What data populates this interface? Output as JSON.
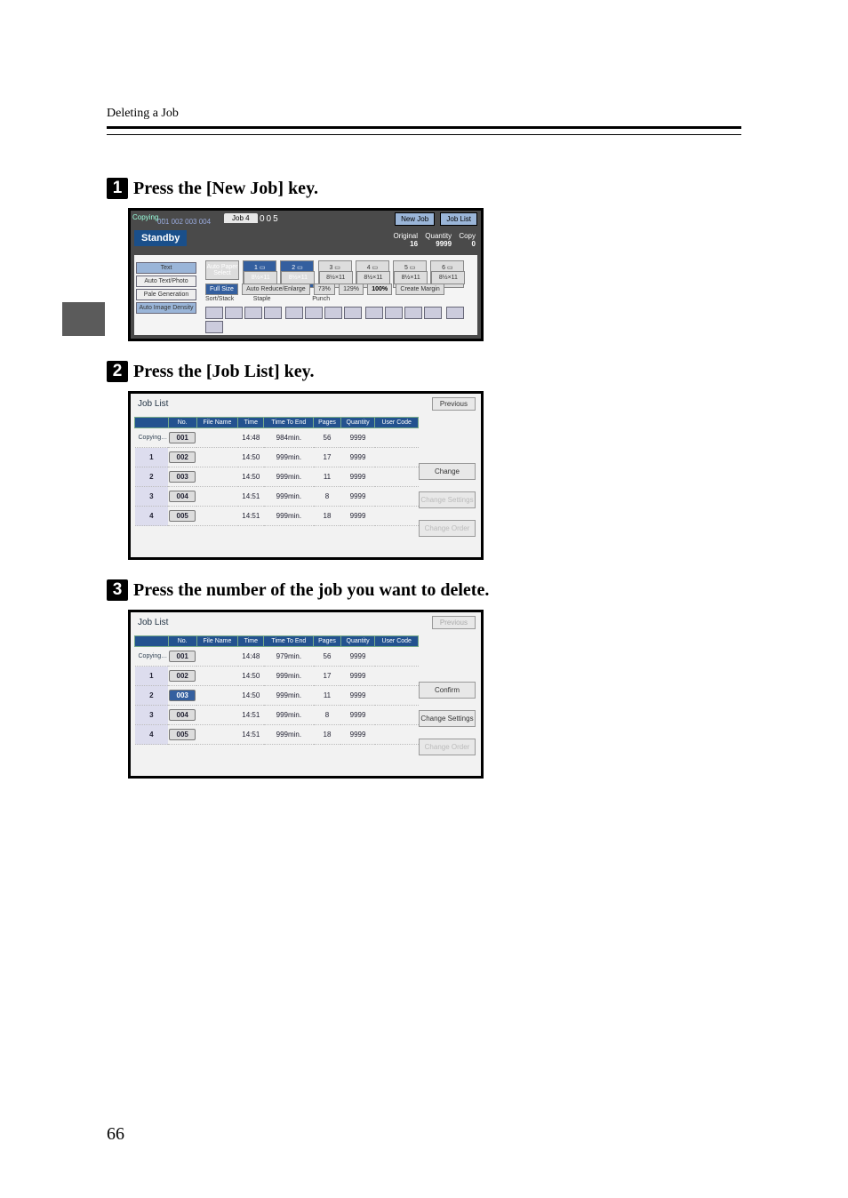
{
  "section_title": "Deleting a Job",
  "steps": {
    "s1_pre": "Press the ",
    "s1_key": "[New Job]",
    "s1_post": " key.",
    "s2_pre": "Press the ",
    "s2_key": "[Job List]",
    "s2_post": " key.",
    "s3": "Press the number of the job you want to delete."
  },
  "page_number": "66",
  "panel1": {
    "copying": "Copying…",
    "tabs": "001  002  003  004",
    "jobtab": "Job 4",
    "jobtab2": "005",
    "new_job": "New Job",
    "job_list": "Job List",
    "standby": "Standby",
    "original_lbl": "Original",
    "original_val": "16",
    "quantity_lbl": "Quantity",
    "quantity_val": "9999",
    "copy_lbl": "Copy",
    "copy_val": "0",
    "text": "Text",
    "photo": "Photo",
    "auto_text_photo": "Auto Text/Photo",
    "pale": "Pale",
    "generation": "Generation",
    "auto_image_density": "Auto Image Density",
    "auto_paper": "Auto Paper Select",
    "tray": "8½×11",
    "full_size": "Full Size",
    "auto_re": "Auto Reduce/Enlarge",
    "p73": "73%",
    "p129": "129%",
    "p100": "100%",
    "create_margin": "Create Margin",
    "sort_stack": "Sort/Stack",
    "staple": "Staple",
    "punch": "Punch"
  },
  "job_list": {
    "title": "Job List",
    "previous": "Previous",
    "change": "Change",
    "confirm": "Confirm",
    "change_settings": "Change Settings",
    "change_order": "Change Order",
    "headers": [
      "No.",
      "File Name",
      "Time",
      "Time To End",
      "Pages",
      "Quantity",
      "User Code"
    ],
    "rows_a": [
      {
        "idx": "Copying…",
        "no": "001",
        "fn": "",
        "time": "14:48",
        "tte": "984min.",
        "pages": "56",
        "qty": "9999",
        "uc": ""
      },
      {
        "idx": "1",
        "no": "002",
        "fn": "",
        "time": "14:50",
        "tte": "999min.",
        "pages": "17",
        "qty": "9999",
        "uc": ""
      },
      {
        "idx": "2",
        "no": "003",
        "fn": "",
        "time": "14:50",
        "tte": "999min.",
        "pages": "11",
        "qty": "9999",
        "uc": ""
      },
      {
        "idx": "3",
        "no": "004",
        "fn": "",
        "time": "14:51",
        "tte": "999min.",
        "pages": "8",
        "qty": "9999",
        "uc": ""
      },
      {
        "idx": "4",
        "no": "005",
        "fn": "",
        "time": "14:51",
        "tte": "999min.",
        "pages": "18",
        "qty": "9999",
        "uc": ""
      }
    ],
    "rows_b": [
      {
        "idx": "Copying…",
        "no": "001",
        "fn": "",
        "time": "14:48",
        "tte": "979min.",
        "pages": "56",
        "qty": "9999",
        "uc": ""
      },
      {
        "idx": "1",
        "no": "002",
        "fn": "",
        "time": "14:50",
        "tte": "999min.",
        "pages": "17",
        "qty": "9999",
        "uc": ""
      },
      {
        "idx": "2",
        "no": "003",
        "fn": "",
        "time": "14:50",
        "tte": "999min.",
        "pages": "11",
        "qty": "9999",
        "uc": "",
        "sel": true
      },
      {
        "idx": "3",
        "no": "004",
        "fn": "",
        "time": "14:51",
        "tte": "999min.",
        "pages": "8",
        "qty": "9999",
        "uc": ""
      },
      {
        "idx": "4",
        "no": "005",
        "fn": "",
        "time": "14:51",
        "tte": "999min.",
        "pages": "18",
        "qty": "9999",
        "uc": ""
      }
    ]
  }
}
